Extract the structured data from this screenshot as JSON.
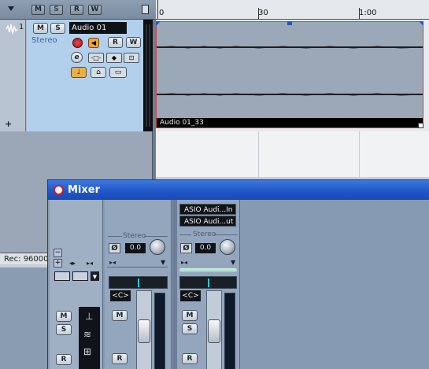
{
  "project": {
    "toolbar": {
      "buttons": [
        "M",
        "S",
        "R",
        "W"
      ],
      "dropdown_icon": "triangle-down-icon",
      "window_icon": "window-icon"
    },
    "ruler": {
      "labels": [
        "0",
        "30",
        "1:00"
      ]
    },
    "track": {
      "number": "1",
      "name": "Audio 01",
      "channel_config": "Stereo",
      "buttons": {
        "mute": "M",
        "solo": "S",
        "read": "R",
        "write": "W",
        "edit": "e"
      }
    },
    "event": {
      "name": "Audio 01_33"
    },
    "status": "Rec: 96000"
  },
  "mixer": {
    "title": "Mixer",
    "common_panel": {
      "buttons": [
        "M",
        "S",
        "R"
      ]
    },
    "channels": [
      {
        "name": "input-channel",
        "label": "Stereo",
        "gain": "0.0",
        "phase": "Ø",
        "pan": "<C>",
        "mute": "M",
        "read": "R"
      },
      {
        "name": "audio-channel",
        "input": "ASIO Audi...In",
        "output": "ASIO Audi...ut",
        "label": "Stereo",
        "gain": "0.0",
        "phase": "Ø",
        "pan": "<C>",
        "mute": "M",
        "solo": "S",
        "read": "R"
      }
    ]
  },
  "colors": {
    "event_border": "#c6424a",
    "title_bar": "#1f55c7",
    "pan_indicator": "#32c8d8"
  }
}
